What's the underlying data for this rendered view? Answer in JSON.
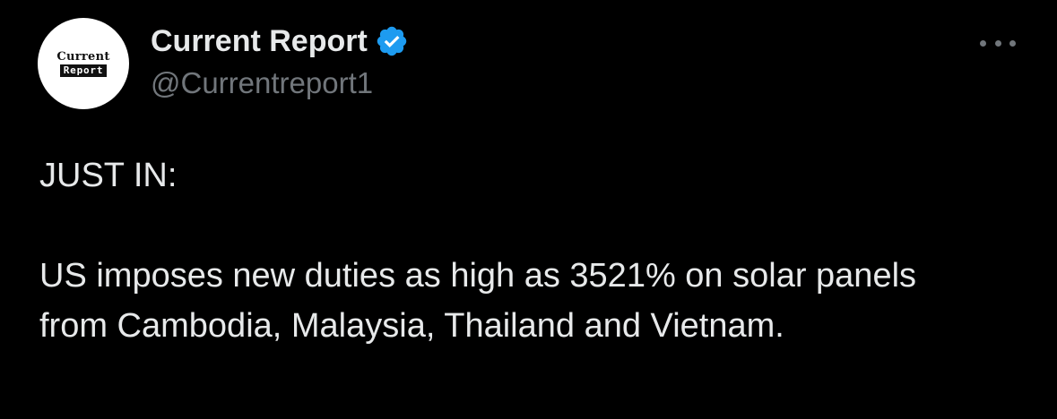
{
  "author": {
    "display_name": "Current Report",
    "handle": "@Currentreport1",
    "verified": true,
    "avatar_logo": {
      "top_text": "Current",
      "bottom_text": "Report"
    }
  },
  "post": {
    "line1": "JUST IN:",
    "line2": "US imposes new duties as high as 3521% on solar panels from Cambodia, Malaysia, Thailand and Vietnam."
  },
  "icons": {
    "verified": "verified-badge-icon",
    "more": "more-options-icon"
  },
  "colors": {
    "background": "#000000",
    "text": "#e7e9ea",
    "secondary_text": "#71767b",
    "verified_blue": "#1d9bf0"
  }
}
